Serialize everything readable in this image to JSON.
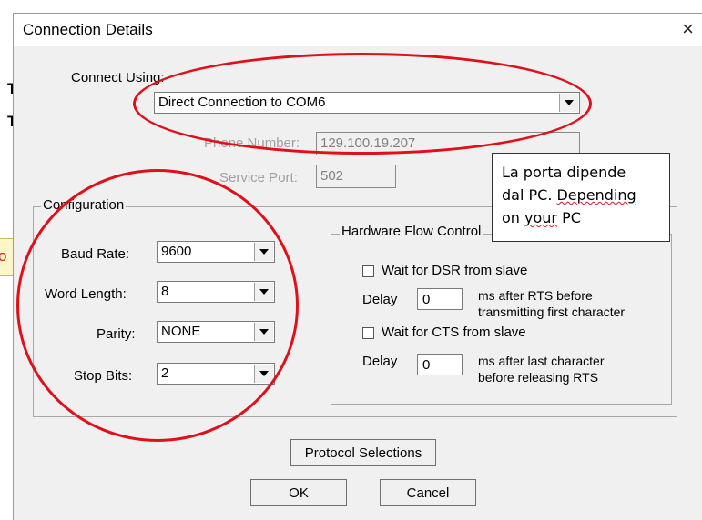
{
  "background": {
    "fragments": [
      "T",
      "T",
      "o"
    ]
  },
  "dialog": {
    "title": "Connection Details",
    "close_glyph": "×",
    "connect_using": {
      "label": "Connect Using:",
      "value": "Direct Connection to COM6"
    },
    "phone_number": {
      "label": "Phone Number:",
      "value": "129.100.19.207"
    },
    "service_port": {
      "label": "Service Port:",
      "value": "502"
    },
    "configuration": {
      "title": "Configuration",
      "baud_rate": {
        "label": "Baud Rate:",
        "value": "9600"
      },
      "word_length": {
        "label": "Word Length:",
        "value": "8"
      },
      "parity": {
        "label": "Parity:",
        "value": "NONE"
      },
      "stop_bits": {
        "label": "Stop Bits:",
        "value": "2"
      }
    },
    "hardware_flow": {
      "title": "Hardware Flow Control",
      "dsr": {
        "label": "Wait for DSR from slave",
        "checked": false,
        "delay_label": "Delay",
        "delay_value": "0",
        "desc_line1": "ms after RTS before",
        "desc_line2": "transmitting first character"
      },
      "cts": {
        "label": "Wait for CTS from slave",
        "checked": false,
        "delay_label": "Delay",
        "delay_value": "0",
        "desc_line1": "ms after last character",
        "desc_line2": "before releasing RTS"
      }
    },
    "buttons": {
      "protocol": "Protocol Selections",
      "ok": "OK",
      "cancel": "Cancel"
    }
  },
  "annotation": {
    "line1": "La porta dipende",
    "line2a": "dal PC. ",
    "line2b": "Depending",
    "line3a": "on ",
    "line3b": "your",
    "line3c": " PC"
  },
  "colors": {
    "highlight_ellipse": "#e0101a",
    "dialog_bg": "#f0f0f0"
  }
}
